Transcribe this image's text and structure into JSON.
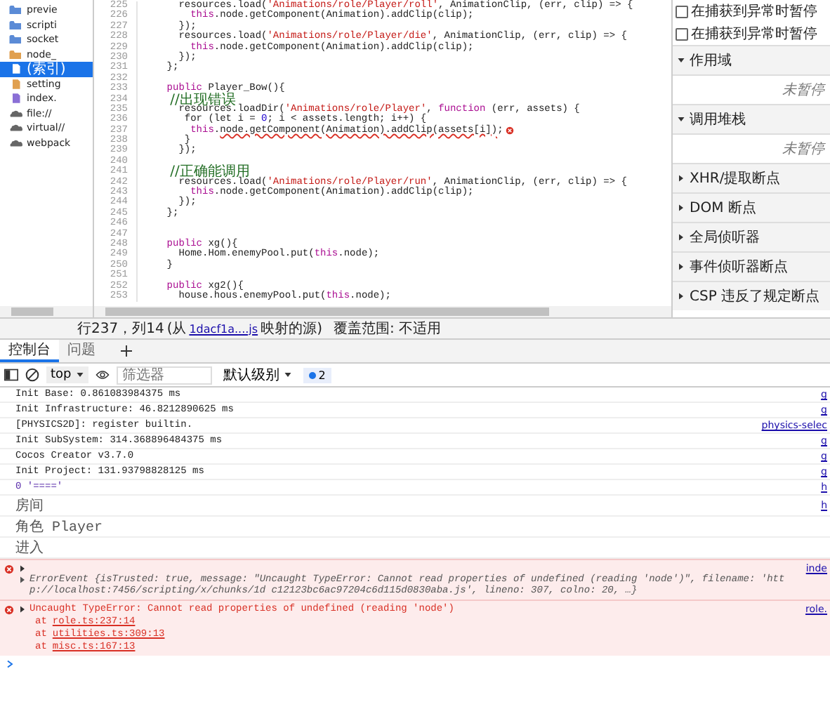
{
  "sources": {
    "items": [
      {
        "label": "previe",
        "kind": "folder",
        "color": "#5b8bd6",
        "selected": false
      },
      {
        "label": "scripti",
        "kind": "folder",
        "color": "#5b8bd6",
        "selected": false
      },
      {
        "label": "socket",
        "kind": "folder",
        "color": "#5b8bd6",
        "selected": false
      },
      {
        "label": "node_",
        "kind": "folder",
        "color": "#e0a050",
        "selected": false
      },
      {
        "label": "(索引)",
        "kind": "file",
        "color": "#ffffff",
        "selected": true
      },
      {
        "label": "setting",
        "kind": "file",
        "color": "#e0a050",
        "selected": false
      },
      {
        "label": "index.",
        "kind": "file",
        "color": "#8a6fd6",
        "selected": false
      },
      {
        "label": "file://",
        "kind": "origin",
        "color": "#666666",
        "selected": false
      },
      {
        "label": "virtual//",
        "kind": "origin",
        "color": "#666666",
        "selected": false
      },
      {
        "label": "webpack",
        "kind": "origin",
        "color": "#666666",
        "selected": false
      }
    ]
  },
  "editor": {
    "lines": [
      {
        "n": "225",
        "segs": [
          {
            "kind": "plain",
            "text": "      resources.load("
          },
          {
            "kind": "string",
            "text": "'Animations/role/Player/roll'"
          },
          {
            "kind": "plain",
            "text": ", AnimationClip, (err, clip) => {"
          }
        ]
      },
      {
        "n": "226",
        "segs": [
          {
            "kind": "keyword",
            "text": "        this"
          },
          {
            "kind": "plain",
            "text": ".node.getComponent(Animation).addClip(clip);"
          }
        ]
      },
      {
        "n": "227",
        "segs": [
          {
            "kind": "plain",
            "text": "      });"
          }
        ]
      },
      {
        "n": "228",
        "segs": [
          {
            "kind": "plain",
            "text": "      resources.load("
          },
          {
            "kind": "string",
            "text": "'Animations/role/Player/die'"
          },
          {
            "kind": "plain",
            "text": ", AnimationClip, (err, clip) => {"
          }
        ]
      },
      {
        "n": "229",
        "segs": [
          {
            "kind": "keyword",
            "text": "        this"
          },
          {
            "kind": "plain",
            "text": ".node.getComponent(Animation).addClip(clip);"
          }
        ]
      },
      {
        "n": "230",
        "segs": [
          {
            "kind": "plain",
            "text": "      });"
          }
        ]
      },
      {
        "n": "231",
        "segs": [
          {
            "kind": "plain",
            "text": "    };"
          }
        ]
      },
      {
        "n": "232"
      },
      {
        "n": "233",
        "segs": [
          {
            "kind": "keyword",
            "text": "    public"
          },
          {
            "kind": "plain",
            "text": " Player_Bow(){"
          }
        ]
      },
      {
        "n": "234",
        "segs": [
          {
            "kind": "comment",
            "text": "      //出现错误"
          }
        ]
      },
      {
        "n": "235",
        "segs": [
          {
            "kind": "plain",
            "text": "      resources.loadDir("
          },
          {
            "kind": "string",
            "text": "'Animations/role/Player'"
          },
          {
            "kind": "plain",
            "text": ", "
          },
          {
            "kind": "keyword",
            "text": "function"
          },
          {
            "kind": "plain",
            "text": " (err, assets) {"
          }
        ]
      },
      {
        "n": "236",
        "segs": [
          {
            "kind": "plain",
            "text": "       for (let i = "
          },
          {
            "kind": "number",
            "text": "0"
          },
          {
            "kind": "plain",
            "text": "; i < assets.length; i++) {"
          }
        ]
      },
      {
        "n": "237",
        "segs": [
          {
            "kind": "keyword",
            "text": "        this"
          },
          {
            "kind": "plain",
            "text": "."
          },
          {
            "kind": "error",
            "text": "node.getComponent(Animation).addClip(assets[i])"
          },
          {
            "kind": "plain",
            "text": ";"
          },
          {
            "kind": "error-marker"
          }
        ]
      },
      {
        "n": "238",
        "segs": [
          {
            "kind": "plain",
            "text": "       }"
          }
        ]
      },
      {
        "n": "239",
        "segs": [
          {
            "kind": "plain",
            "text": "      });"
          }
        ]
      },
      {
        "n": "240"
      },
      {
        "n": "241",
        "segs": [
          {
            "kind": "comment",
            "text": "      //正确能调用"
          }
        ]
      },
      {
        "n": "242",
        "segs": [
          {
            "kind": "plain",
            "text": "      resources.load("
          },
          {
            "kind": "string",
            "text": "'Animations/role/Player/run'"
          },
          {
            "kind": "plain",
            "text": ", AnimationClip, (err, clip) => {"
          }
        ]
      },
      {
        "n": "243",
        "segs": [
          {
            "kind": "keyword",
            "text": "        this"
          },
          {
            "kind": "plain",
            "text": ".node.getComponent(Animation).addClip(clip);"
          }
        ]
      },
      {
        "n": "244",
        "segs": [
          {
            "kind": "plain",
            "text": "      });"
          }
        ]
      },
      {
        "n": "245",
        "segs": [
          {
            "kind": "plain",
            "text": "    };"
          }
        ]
      },
      {
        "n": "246"
      },
      {
        "n": "247"
      },
      {
        "n": "248",
        "segs": [
          {
            "kind": "keyword",
            "text": "    public"
          },
          {
            "kind": "plain",
            "text": " xg(){"
          }
        ]
      },
      {
        "n": "249",
        "segs": [
          {
            "kind": "plain",
            "text": "      Home.Hom.enemyPool.put("
          },
          {
            "kind": "keyword",
            "text": "this"
          },
          {
            "kind": "plain",
            "text": ".node);"
          }
        ]
      },
      {
        "n": "250",
        "segs": [
          {
            "kind": "plain",
            "text": "    }"
          }
        ]
      },
      {
        "n": "251"
      },
      {
        "n": "252",
        "segs": [
          {
            "kind": "keyword",
            "text": "    public"
          },
          {
            "kind": "plain",
            "text": " xg2(){"
          }
        ]
      },
      {
        "n": "253",
        "segs": [
          {
            "kind": "plain",
            "text": "      house.hous.enemyPool.put("
          },
          {
            "kind": "keyword",
            "text": "this"
          },
          {
            "kind": "plain",
            "text": ".node);"
          }
        ]
      }
    ]
  },
  "debugger": {
    "items": [
      {
        "kind": "checkbox",
        "label": "在捕获到异常时暂停",
        "checked": false
      },
      {
        "kind": "checkbox",
        "label": "在捕获到异常时暂停",
        "checked": false
      },
      {
        "kind": "section",
        "label": "作用域",
        "expanded": true
      },
      {
        "kind": "note",
        "label": "未暂停"
      },
      {
        "kind": "section",
        "label": "调用堆栈",
        "expanded": true
      },
      {
        "kind": "note",
        "label": "未暂停"
      },
      {
        "kind": "section",
        "label": "XHR/提取断点",
        "expanded": false
      },
      {
        "kind": "section",
        "label": "DOM 断点",
        "expanded": false
      },
      {
        "kind": "section",
        "label": "全局侦听器",
        "expanded": false
      },
      {
        "kind": "section",
        "label": "事件侦听器断点",
        "expanded": false
      },
      {
        "kind": "section",
        "label": "CSP 违反了规定断点",
        "expanded": false
      }
    ]
  },
  "status_bar": {
    "position": "行237，列14",
    "prefix": "(从",
    "link": "1dacf1a....js",
    "suffix": "映射的源)",
    "coverage": "覆盖范围: 不适用"
  },
  "drawer_tabs": [
    {
      "label": "控制台",
      "selected": true
    },
    {
      "label": "问题",
      "selected": false
    }
  ],
  "toolbar": {
    "context": "top",
    "filter_placeholder": "筛选器",
    "level": "默认级别",
    "issues": "2"
  },
  "console": [
    {
      "kind": "log",
      "text": "Init Base: 0.861083984375 ms",
      "source": "g"
    },
    {
      "kind": "log",
      "text": "Init Infrastructure: 46.8212890625 ms",
      "source": "g"
    },
    {
      "kind": "log",
      "text": "[PHYSICS2D]: register builtin.",
      "source": "physics-selec"
    },
    {
      "kind": "log",
      "text": "Init SubSystem: 314.368896484375 ms",
      "source": "g"
    },
    {
      "kind": "log",
      "text": "Cocos Creator v3.7.0",
      "source": "g"
    },
    {
      "kind": "log",
      "text": "Init Project: 131.93798828125 ms",
      "source": "g"
    },
    {
      "kind": "value",
      "text": "0 '===='",
      "source": "h"
    },
    {
      "kind": "log",
      "text": "房间",
      "source": "h"
    },
    {
      "kind": "log",
      "text": "角色 Player"
    },
    {
      "kind": "log",
      "text": "进入"
    },
    {
      "kind": "error-event",
      "source": "inde",
      "text": "ErrorEvent {isTrusted: true, message: \"Uncaught TypeError: Cannot read properties of undefined (reading 'node')\", filename: 'http://localhost:7456/scripting/x/chunks/1d c12123bc6ac97204c6d115d0830aba.js', lineno: 307, colno: 20, …}"
    },
    {
      "kind": "error",
      "source": "role.",
      "text": "Uncaught TypeError: Cannot read properties of undefined (reading 'node')",
      "stack": [
        {
          "prefix": "at",
          "link": "role.ts:237:14"
        },
        {
          "prefix": "at",
          "link": "utilities.ts:309:13"
        },
        {
          "prefix": "at",
          "link": "misc.ts:167:13"
        }
      ]
    }
  ]
}
